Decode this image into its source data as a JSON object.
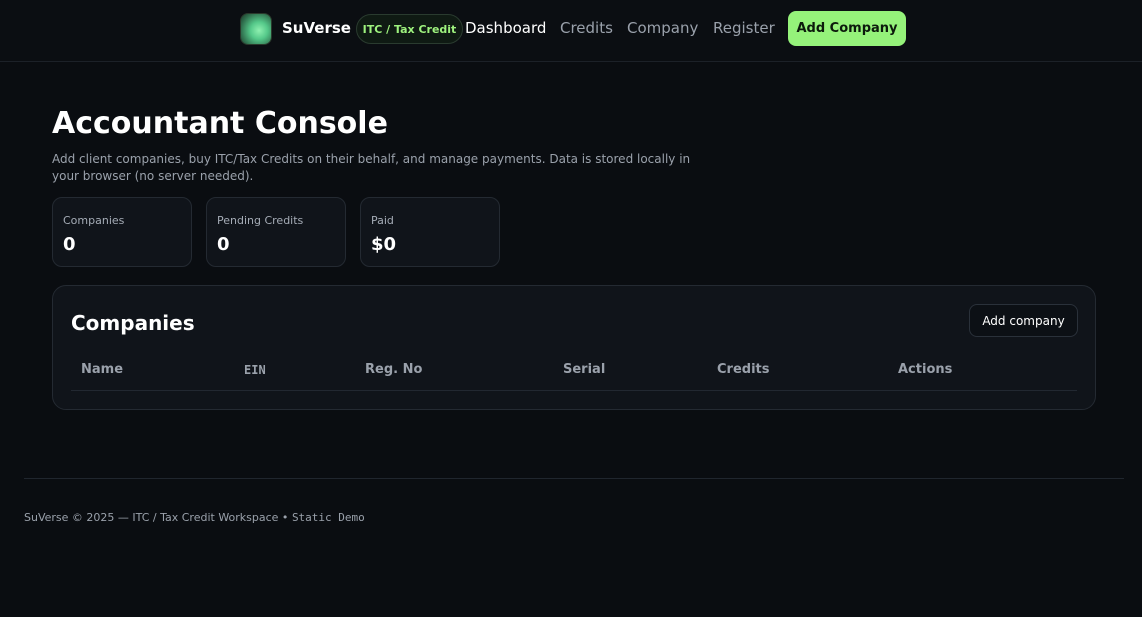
{
  "header": {
    "brand": "SuVerse",
    "pill": "ITC / Tax Credit",
    "nav": [
      "Dashboard",
      "Credits",
      "Company",
      "Register"
    ],
    "active_nav": "Dashboard",
    "cta": "Add Company"
  },
  "main": {
    "title": "Accountant Console",
    "subtitle": "Add client companies, buy ITC/Tax Credits on their behalf, and manage payments. Data is stored locally in your browser (no server needed).",
    "stats": [
      {
        "label": "Companies",
        "value": "0"
      },
      {
        "label": "Pending Credits",
        "value": "0"
      },
      {
        "label": "Paid",
        "value": "$0"
      }
    ]
  },
  "companies": {
    "title": "Companies",
    "add_label": "Add company",
    "columns": [
      "Name",
      "EIN",
      "Reg. No",
      "Serial",
      "Credits",
      "Actions"
    ]
  },
  "footer": {
    "text": "SuVerse © 2025 — ITC / Tax Credit Workspace •",
    "mode": "Static Demo"
  },
  "colors": {
    "accent": "#95f27a",
    "background": "#0a0d11",
    "card": "#10141a"
  }
}
